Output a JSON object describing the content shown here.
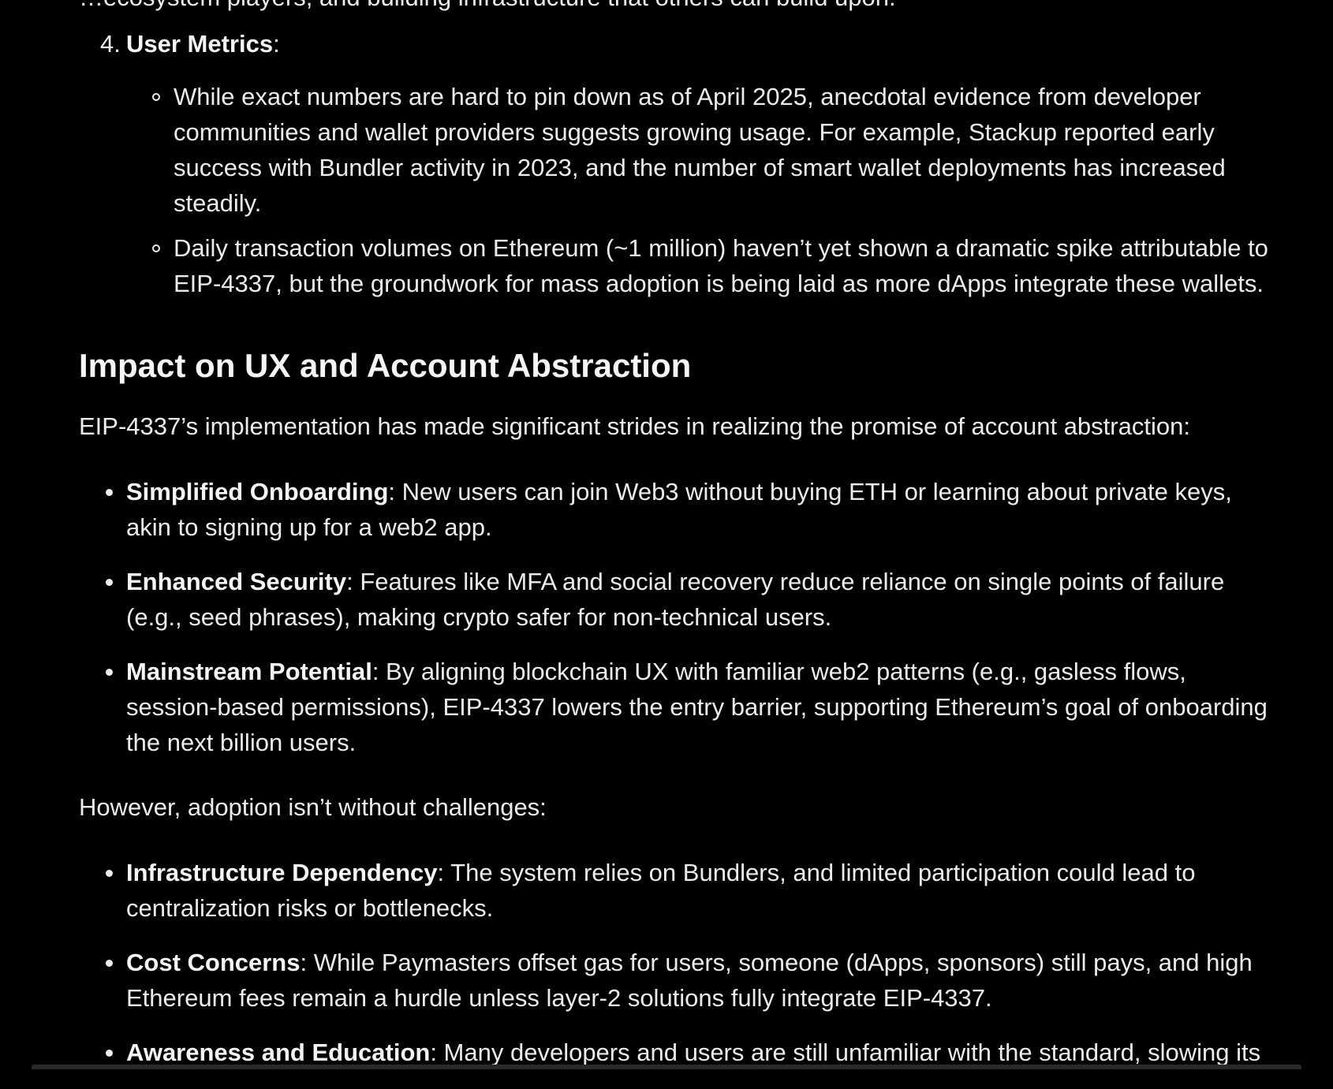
{
  "cut_line": "…ecosystem players, and building infrastructure that others can build upon.",
  "metrics": {
    "number": "4.",
    "title": "User Metrics",
    "items": [
      "While exact numbers are hard to pin down as of April 2025, anecdotal evidence from developer communities and wallet providers suggests growing usage. For example, Stackup reported early success with Bundler activity in 2023, and the number of smart wallet deployments has increased steadily.",
      "Daily transaction volumes on Ethereum (~1 million) haven’t yet shown a dramatic spike attributable to EIP-4337, but the groundwork for mass adoption is being laid as more dApps integrate these wallets."
    ]
  },
  "heading": "Impact on UX and Account Abstraction",
  "intro": "EIP-4337’s implementation has made significant strides in realizing the promise of account abstraction:",
  "benefits": [
    {
      "title": "Simplified Onboarding",
      "text": ": New users can join Web3 without buying ETH or learning about private keys, akin to signing up for a web2 app."
    },
    {
      "title": "Enhanced Security",
      "text": ": Features like MFA and social recovery reduce reliance on single points of failure (e.g., seed phrases), making crypto safer for non-technical users."
    },
    {
      "title": "Mainstream Potential",
      "text": ": By aligning blockchain UX with familiar web2 patterns (e.g., gasless flows, session-based permissions), EIP-4337 lowers the entry barrier, supporting Ethereum’s goal of onboarding the next billion users."
    }
  ],
  "challenges_intro": "However, adoption isn’t without challenges:",
  "challenges": [
    {
      "title": "Infrastructure Dependency",
      "text": ": The system relies on Bundlers, and limited participation could lead to centralization risks or bottlenecks."
    },
    {
      "title": "Cost Concerns",
      "text": ": While Paymasters offset gas for users, someone (dApps, sponsors) still pays, and high Ethereum fees remain a hurdle unless layer-2 solutions fully integrate EIP-4337."
    },
    {
      "title": "Awareness and Education",
      "text": ": Many developers and users are still unfamiliar with the standard, slowing its"
    }
  ]
}
